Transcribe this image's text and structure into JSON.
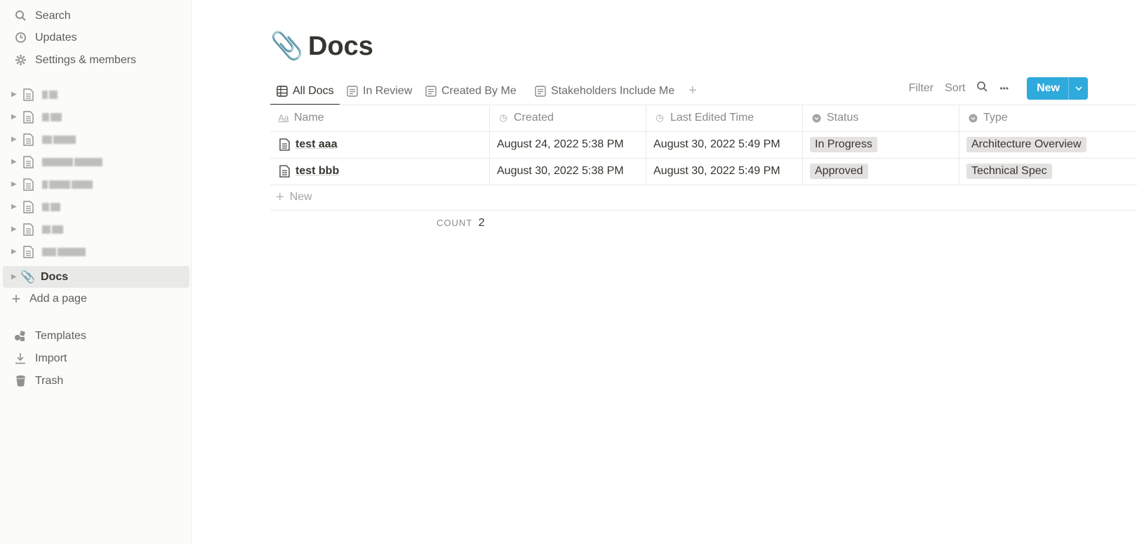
{
  "sidebar": {
    "top_items": [
      {
        "label": "Search",
        "icon": "search-icon"
      },
      {
        "label": "Updates",
        "icon": "clock-icon"
      },
      {
        "label": "Settings & members",
        "icon": "gear-icon"
      }
    ],
    "pages": [
      {
        "label": "",
        "icon": "document-icon"
      },
      {
        "label": "",
        "icon": "document-icon"
      },
      {
        "label": "",
        "icon": "document-icon"
      },
      {
        "label": "",
        "icon": "document-icon"
      },
      {
        "label": "",
        "icon": "document-icon"
      },
      {
        "label": "",
        "icon": "document-icon"
      },
      {
        "label": "",
        "icon": "document-icon"
      },
      {
        "label": "",
        "icon": "document-icon"
      },
      {
        "label": "Docs",
        "icon": "paperclip-icon"
      }
    ],
    "add_page": "Add a page",
    "bottom_items": [
      {
        "label": "Templates",
        "icon": "shapes-icon"
      },
      {
        "label": "Import",
        "icon": "download-icon"
      },
      {
        "label": "Trash",
        "icon": "trash-icon"
      }
    ]
  },
  "page": {
    "emoji": "📎",
    "title": "Docs"
  },
  "tabs": [
    {
      "label": "All Docs",
      "icon": "table-icon",
      "active": true
    },
    {
      "label": "In Review",
      "icon": "list-icon",
      "active": false
    },
    {
      "label": "Created By Me",
      "icon": "list-icon",
      "active": false
    },
    {
      "label": "Stakeholders Include Me",
      "icon": "list-icon",
      "active": false
    }
  ],
  "toolbar": {
    "filter": "Filter",
    "sort": "Sort",
    "more": "•••",
    "new_label": "New",
    "new_caret": "⌄"
  },
  "table": {
    "headers": [
      {
        "label": "Name",
        "icon": "Aa"
      },
      {
        "label": "Created",
        "icon": "◷"
      },
      {
        "label": "Last Edited Time",
        "icon": "◷"
      },
      {
        "label": "Status",
        "icon": "▾"
      },
      {
        "label": "Type",
        "icon": "▾"
      }
    ],
    "rows": [
      {
        "name": "test aaa",
        "created": "August 24, 2022 5:38 PM",
        "edited": "August 30, 2022 5:49 PM",
        "status": "In Progress",
        "type": "Architecture Overview"
      },
      {
        "name": "test bbb",
        "created": "August 30, 2022 5:38 PM",
        "edited": "August 30, 2022 5:49 PM",
        "status": "Approved",
        "type": "Technical Spec"
      }
    ],
    "add_row": "New",
    "count_label": "COUNT",
    "count_value": "2"
  }
}
